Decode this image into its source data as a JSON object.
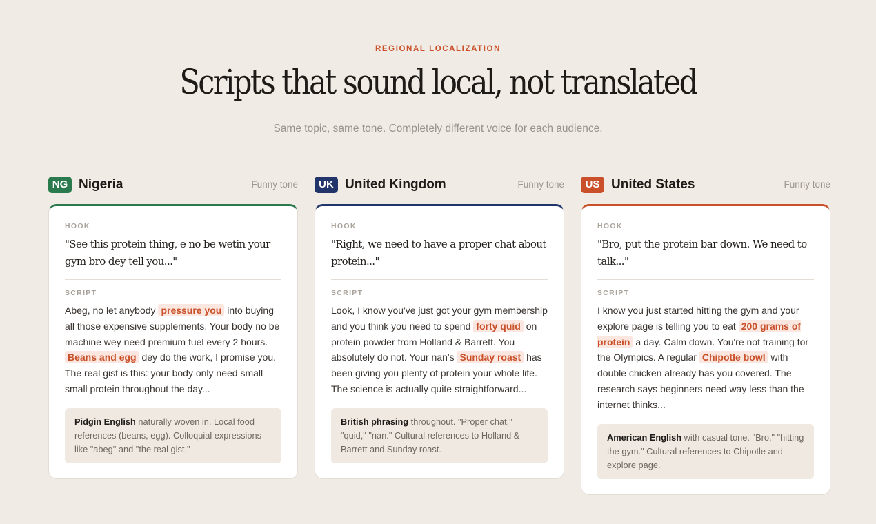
{
  "header": {
    "eyebrow": "REGIONAL LOCALIZATION",
    "title": "Scripts that sound local, not translated",
    "subtitle": "Same topic, same tone. Completely different voice for each audience."
  },
  "labels": {
    "hook": "HOOK",
    "script": "SCRIPT"
  },
  "regions": [
    {
      "code": "NG",
      "country": "Nigeria",
      "tone": "Funny tone",
      "color": "#2a7a4d",
      "hook": "\"See this protein thing, e no be wetin your gym bro dey tell you...\"",
      "script": [
        {
          "t": "Abeg, no let anybody "
        },
        {
          "t": "pressure you",
          "hl": true
        },
        {
          "t": " into buying all those expensive supplements. Your body no be machine wey need premium fuel every 2 hours. "
        },
        {
          "t": "Beans and egg",
          "hl": true
        },
        {
          "t": " dey do the work, I promise you. The real gist is this: your body only need small small protein throughout the day..."
        }
      ],
      "note_strong": "Pidgin English",
      "note_rest": " naturally woven in. Local food references (beans, egg). Colloquial expressions like \"abeg\" and \"the real gist.\""
    },
    {
      "code": "UK",
      "country": "United Kingdom",
      "tone": "Funny tone",
      "color": "#22356b",
      "hook": "\"Right, we need to have a proper chat about protein...\"",
      "script": [
        {
          "t": "Look, I know you've just got your gym membership and you think you need to spend "
        },
        {
          "t": "forty quid",
          "hl": true
        },
        {
          "t": " on protein powder from Holland & Barrett. You absolutely do not. Your nan's "
        },
        {
          "t": "Sunday roast",
          "hl": true
        },
        {
          "t": " has been giving you plenty of protein your whole life. The science is actually quite straightforward..."
        }
      ],
      "note_strong": "British phrasing",
      "note_rest": " throughout. \"Proper chat,\" \"quid,\" \"nan.\" Cultural references to Holland & Barrett and Sunday roast."
    },
    {
      "code": "US",
      "country": "United States",
      "tone": "Funny tone",
      "color": "#c9502a",
      "hook": "\"Bro, put the protein bar down. We need to talk...\"",
      "script": [
        {
          "t": "I know you just started hitting the gym and your explore page is telling you to eat "
        },
        {
          "t": "200 grams of protein",
          "hl": true
        },
        {
          "t": " a day. Calm down. You're not training for the Olympics. A regular "
        },
        {
          "t": "Chipotle bowl",
          "hl": true
        },
        {
          "t": " with double chicken already has you covered. The research says beginners need way less than the internet thinks..."
        }
      ],
      "note_strong": "American English",
      "note_rest": " with casual tone. \"Bro,\" \"hitting the gym.\" Cultural references to Chipotle and explore page."
    }
  ]
}
